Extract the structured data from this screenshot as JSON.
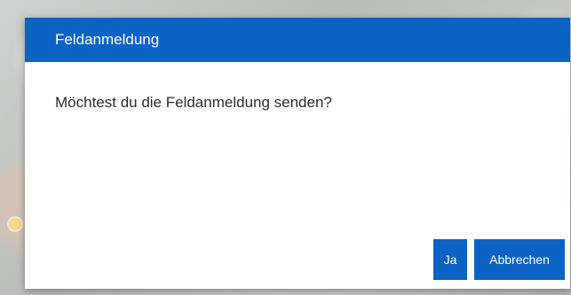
{
  "dialog": {
    "title": "Feldanmeldung",
    "message": "Möchtest du die Feldanmeldung senden?",
    "confirm_label": "Ja",
    "cancel_label": "Abbrechen"
  },
  "colors": {
    "accent": "#0b63c4",
    "dialog_background": "#ffffff",
    "text": "#2a2a2a"
  }
}
